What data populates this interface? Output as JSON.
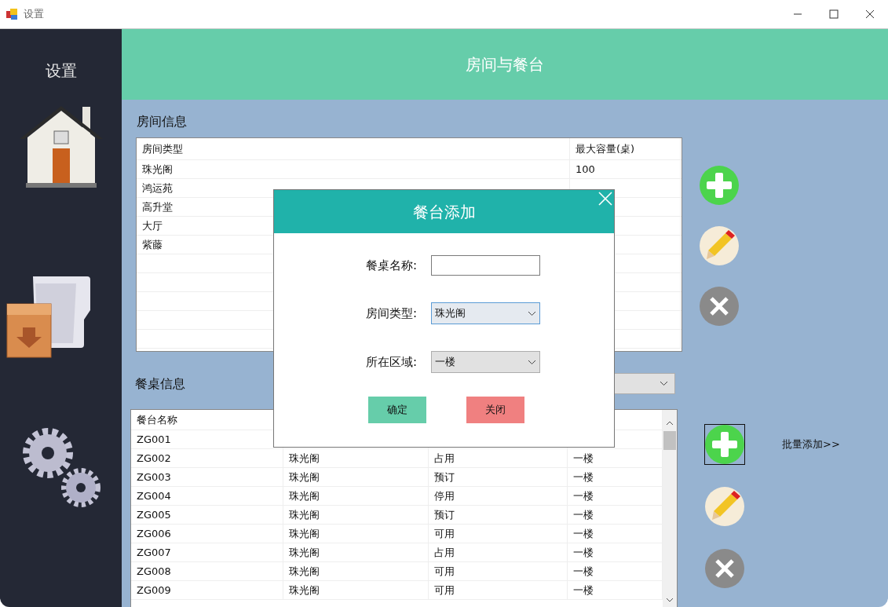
{
  "window": {
    "title": "设置"
  },
  "sidebar": {
    "title": "设置"
  },
  "header": {
    "title": "房间与餐台"
  },
  "rooms": {
    "title": "房间信息",
    "columns": [
      "房间类型",
      "最大容量(桌)"
    ],
    "rows": [
      {
        "type": "珠光阁",
        "capacity": "100"
      },
      {
        "type": "鸿运苑"
      },
      {
        "type": "高升堂"
      },
      {
        "type": "大厅"
      },
      {
        "type": "紫藤"
      }
    ]
  },
  "room_actions": [
    {
      "kind": "add",
      "focused": false
    },
    {
      "kind": "edit",
      "focused": false
    },
    {
      "kind": "delete",
      "focused": false
    }
  ],
  "tables": {
    "title": "餐桌信息",
    "columns": [
      "餐台名称"
    ],
    "rows": [
      {
        "name": "ZG001"
      },
      {
        "name": "ZG002",
        "room": "珠光阁",
        "status": "占用",
        "area": "一楼"
      },
      {
        "name": "ZG003",
        "room": "珠光阁",
        "status": "预订",
        "area": "一楼"
      },
      {
        "name": "ZG004",
        "room": "珠光阁",
        "status": "停用",
        "area": "一楼"
      },
      {
        "name": "ZG005",
        "room": "珠光阁",
        "status": "预订",
        "area": "一楼"
      },
      {
        "name": "ZG006",
        "room": "珠光阁",
        "status": "可用",
        "area": "一楼"
      },
      {
        "name": "ZG007",
        "room": "珠光阁",
        "status": "占用",
        "area": "一楼"
      },
      {
        "name": "ZG008",
        "room": "珠光阁",
        "status": "可用",
        "area": "一楼"
      },
      {
        "name": "ZG009",
        "room": "珠光阁",
        "status": "可用",
        "area": "一楼"
      }
    ]
  },
  "table_actions": [
    {
      "kind": "add",
      "focused": true
    },
    {
      "kind": "edit",
      "focused": false
    },
    {
      "kind": "delete",
      "focused": false
    }
  ],
  "batch_add": "批量添加>>",
  "dialog": {
    "title": "餐台添加",
    "fields": [
      {
        "label": "餐桌名称:",
        "kind": "text",
        "focused": false
      },
      {
        "label": "房间类型:",
        "kind": "select",
        "value": "珠光阁",
        "focused": true
      },
      {
        "label": "所在区域:",
        "kind": "select",
        "value": "一楼",
        "focused": false
      }
    ],
    "buttons": [
      {
        "label": "确定",
        "kind": "confirm"
      },
      {
        "label": "关闭",
        "kind": "cancel"
      }
    ]
  }
}
